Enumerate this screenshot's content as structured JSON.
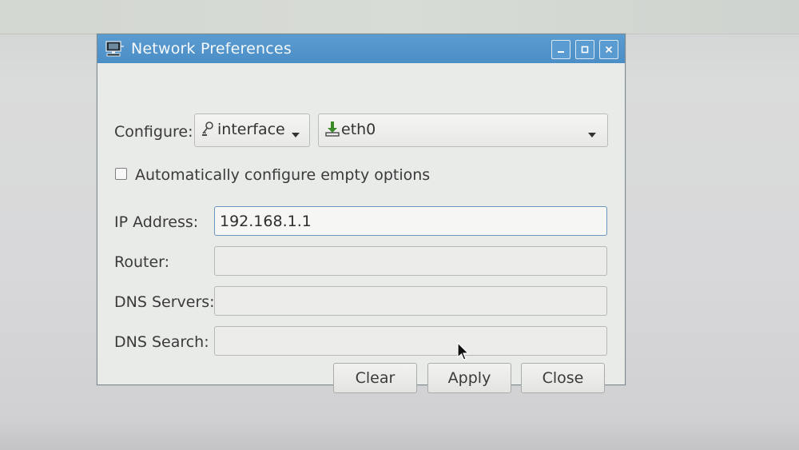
{
  "window": {
    "title": "Network Preferences",
    "icon": "network-computer-icon",
    "controls": [
      "minimize-icon",
      "maximize-icon",
      "close-icon"
    ]
  },
  "configure": {
    "label": "Configure:",
    "type_select": {
      "value": "interface",
      "icon": "key-icon"
    },
    "device_select": {
      "value": "eth0",
      "icon": "ethernet-icon"
    }
  },
  "auto_config": {
    "label": "Automatically configure empty options",
    "checked": false
  },
  "fields": {
    "ip_address": {
      "label": "IP Address:",
      "value": "192.168.1.1"
    },
    "router": {
      "label": "Router:",
      "value": ""
    },
    "dns_servers": {
      "label": "DNS Servers:",
      "value": ""
    },
    "dns_search": {
      "label": "DNS Search:",
      "value": ""
    }
  },
  "buttons": {
    "clear": "Clear",
    "apply": "Apply",
    "close": "Close"
  },
  "colors": {
    "titlebar": "#4b8ec6",
    "dialog_bg": "#e9ebe8",
    "focus_border": "#6a95bd"
  }
}
